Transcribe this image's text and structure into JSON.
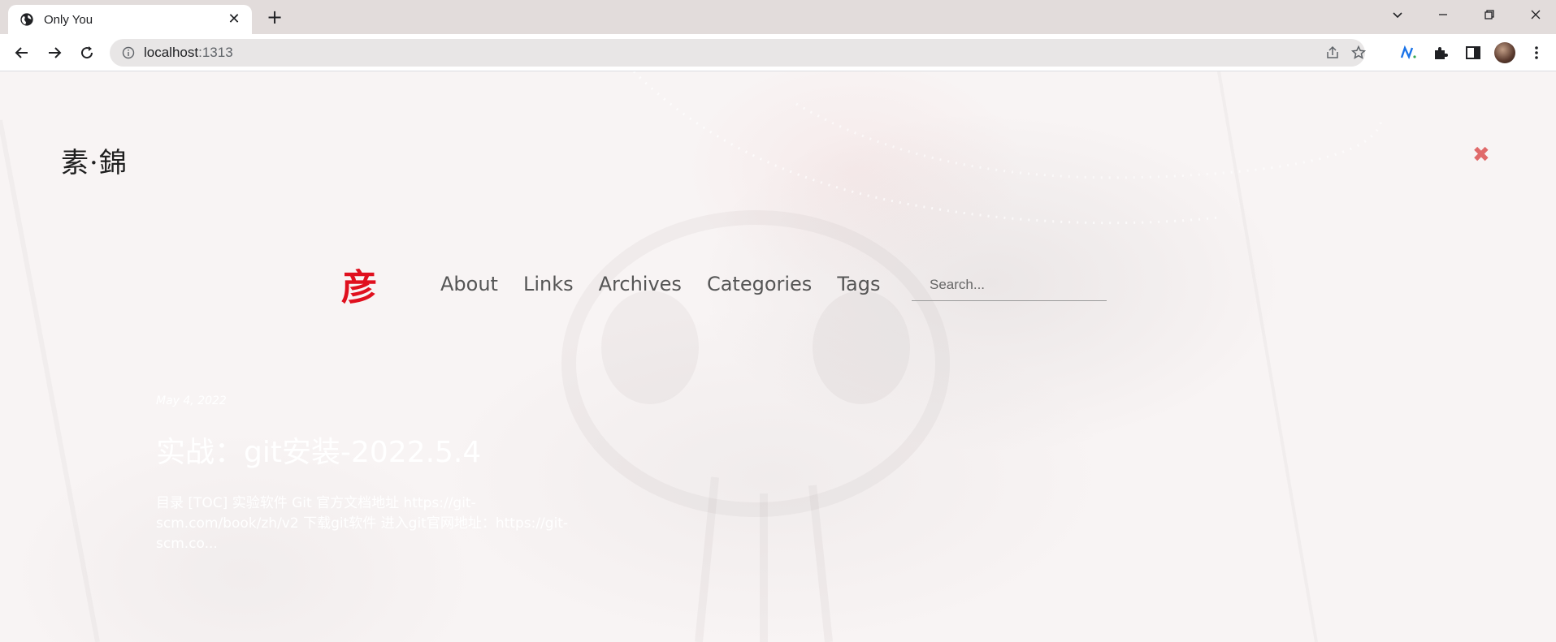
{
  "browser": {
    "tab_title": "Only You",
    "url_host": "localhost",
    "url_port": ":1313"
  },
  "site": {
    "brand": "素·錦",
    "nav_logo": "彦",
    "nav": [
      "About",
      "Links",
      "Archives",
      "Categories",
      "Tags"
    ],
    "search_placeholder": "Search..."
  },
  "post": {
    "date": "May 4, 2022",
    "title": "实战：git安装-2022.5.4",
    "excerpt": "目录 [TOC] 实验软件 Git 官方文档地址 https://git-scm.com/book/zh/v2 下载git软件 进入git官网地址：https://git-scm.co..."
  },
  "colors": {
    "logo": "#e0101e",
    "close": "#e06a6a",
    "tabstrip": "#e2dcdb"
  }
}
